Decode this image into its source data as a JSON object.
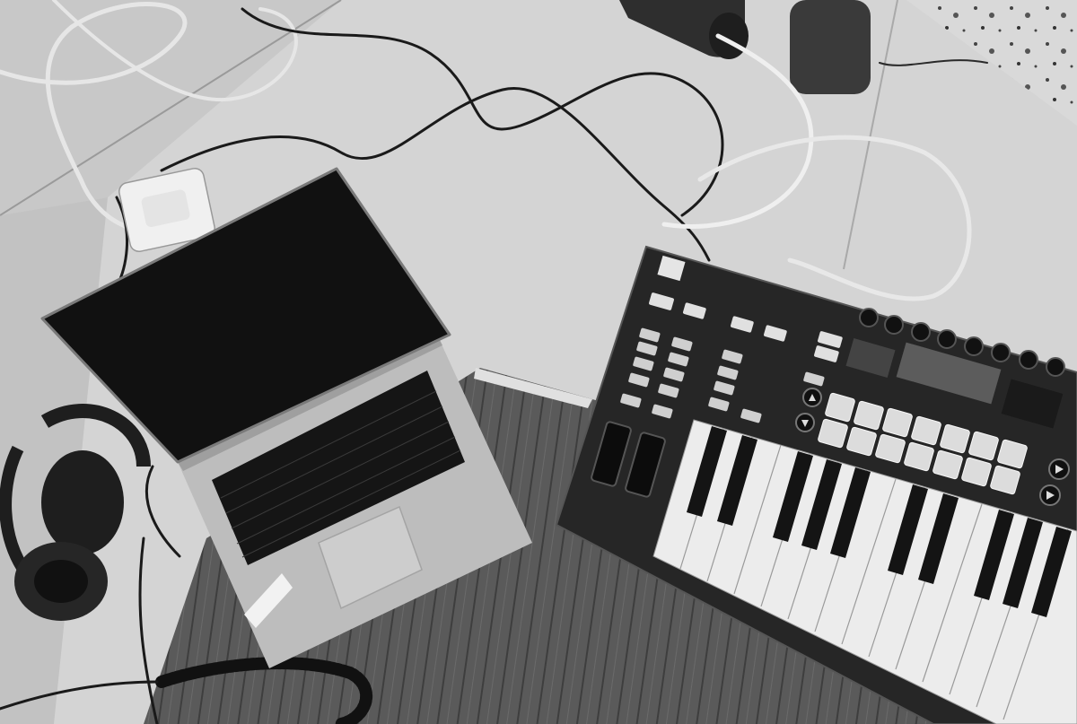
{
  "photo": {
    "style": "black-and-white film photograph, top-down view",
    "colors": {
      "floor": "#d6d6d6",
      "rug": "#5a5a5a",
      "laptop_body": "#c4c4c4",
      "screen": "#111111",
      "keyboard": "#1a1a1a",
      "controller": "#262626",
      "white_key": "#ececec",
      "black_key": "#141414",
      "pad": "#dcdcdc"
    }
  },
  "objects": [
    {
      "name": "laptop",
      "icon": "laptop-icon"
    },
    {
      "name": "midi-keyboard-controller",
      "icon": "piano-keys-icon"
    },
    {
      "name": "headphones",
      "icon": "headphones-icon"
    },
    {
      "name": "power-adapter",
      "icon": "power-brick-icon"
    },
    {
      "name": "cables",
      "icon": "cable-icon"
    },
    {
      "name": "bamboo-rug",
      "icon": "mat-icon"
    },
    {
      "name": "speaker-stand",
      "icon": "speaker-icon"
    }
  ]
}
